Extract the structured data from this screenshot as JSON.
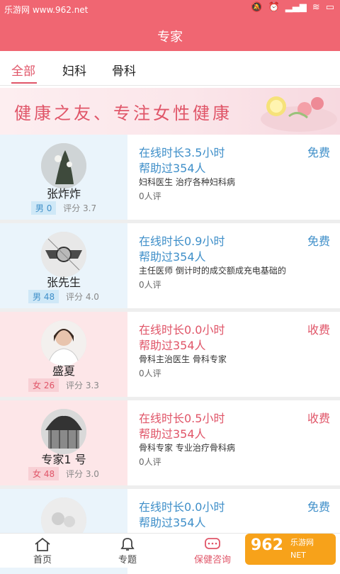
{
  "statusbar": {
    "left_text": "乐游网 www.962.net",
    "time": "",
    "icons": [
      "mute-icon",
      "alarm-icon",
      "signal-icon",
      "wifi-icon",
      "battery-icon"
    ]
  },
  "appbar": {
    "title": "专家"
  },
  "tabs": [
    {
      "label": "全部",
      "active": true
    },
    {
      "label": "妇科",
      "active": false
    },
    {
      "label": "骨科",
      "active": false
    }
  ],
  "banner": {
    "slogan": "健康之友、专注女性健康"
  },
  "experts": [
    {
      "theme": "blue",
      "name": "张炸炸",
      "gender": "男",
      "age": "0",
      "rating_label": "评分",
      "rating": "3.7",
      "online": "在线时长3.5小时",
      "helped": "帮助过354人",
      "price": "免费",
      "desc": "妇科医生 治疗各种妇科病",
      "reviews": "0人评"
    },
    {
      "theme": "blue",
      "name": "张先生",
      "gender": "男",
      "age": "48",
      "rating_label": "评分",
      "rating": "4.0",
      "online": "在线时长0.9小时",
      "helped": "帮助过354人",
      "price": "免费",
      "desc": "主任医师 倒计时的成交额成充电基础的",
      "reviews": "0人评"
    },
    {
      "theme": "red",
      "name": "盛夏",
      "gender": "女",
      "age": "26",
      "rating_label": "评分",
      "rating": "3.3",
      "online": "在线时长0.0小时",
      "helped": "帮助过354人",
      "price": "收费",
      "desc": "骨科主治医生 骨科专家",
      "reviews": "0人评"
    },
    {
      "theme": "red",
      "name": "专家1 号",
      "gender": "女",
      "age": "48",
      "rating_label": "评分",
      "rating": "3.0",
      "online": "在线时长0.5小时",
      "helped": "帮助过354人",
      "price": "收费",
      "desc": "骨科专家 专业治疗骨科病",
      "reviews": "0人评"
    },
    {
      "theme": "blue",
      "name": "",
      "gender": "",
      "age": "",
      "rating_label": "",
      "rating": "",
      "online": "在线时长0.0小时",
      "helped": "帮助过354人",
      "price": "免费",
      "desc": "",
      "reviews": ""
    }
  ],
  "bottomnav": [
    {
      "label": "首页",
      "icon": "home-icon",
      "active": false
    },
    {
      "label": "专题",
      "icon": "bell-icon",
      "active": false
    },
    {
      "label": "保健咨询",
      "icon": "chat-icon",
      "active": true
    },
    {
      "label": "",
      "icon": "",
      "active": false
    }
  ],
  "watermark": {
    "big": "962",
    "small1": "乐游网",
    "small2": "NET"
  },
  "colors": {
    "primary": "#f06672",
    "blue": "#3f8fc9",
    "red": "#e05568"
  }
}
